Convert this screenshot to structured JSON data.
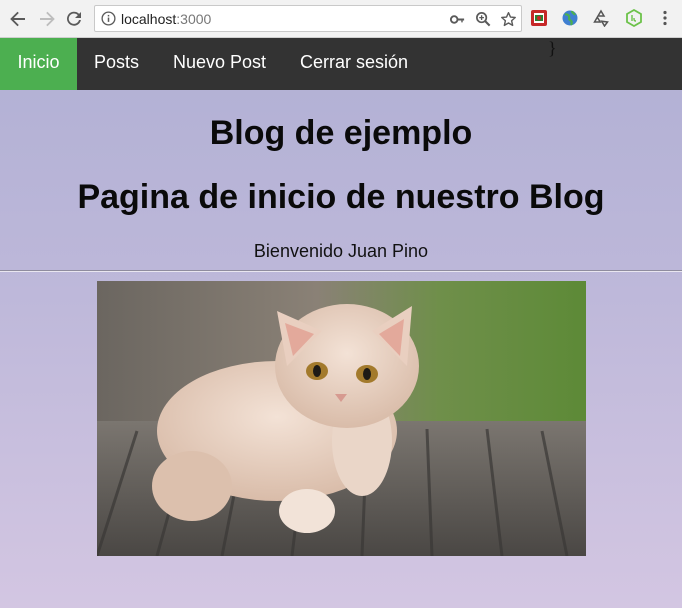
{
  "browser": {
    "url_host": "localhost",
    "url_port": ":3000"
  },
  "page": {
    "stray_text": "}",
    "nav": {
      "items": [
        {
          "label": "Inicio"
        },
        {
          "label": "Posts"
        },
        {
          "label": "Nuevo Post"
        },
        {
          "label": "Cerrar sesión"
        }
      ]
    },
    "title": "Blog de ejemplo",
    "subtitle": "Pagina de inicio de nuestro Blog",
    "welcome": "Bienvenido Juan Pino",
    "image": {
      "subject": "kitten"
    }
  },
  "colors": {
    "nav_bg": "#333333",
    "nav_active": "#4caf50",
    "page_bg_top": "#b1b0d4",
    "page_bg_bottom": "#d3c6e2"
  },
  "icons": [
    "back-arrow-icon",
    "forward-arrow-icon",
    "reload-icon",
    "info-icon",
    "key-icon",
    "zoom-icon",
    "star-icon",
    "extension-icon",
    "globe-icon",
    "recycle-icon",
    "node-icon",
    "menu-dots-icon"
  ]
}
